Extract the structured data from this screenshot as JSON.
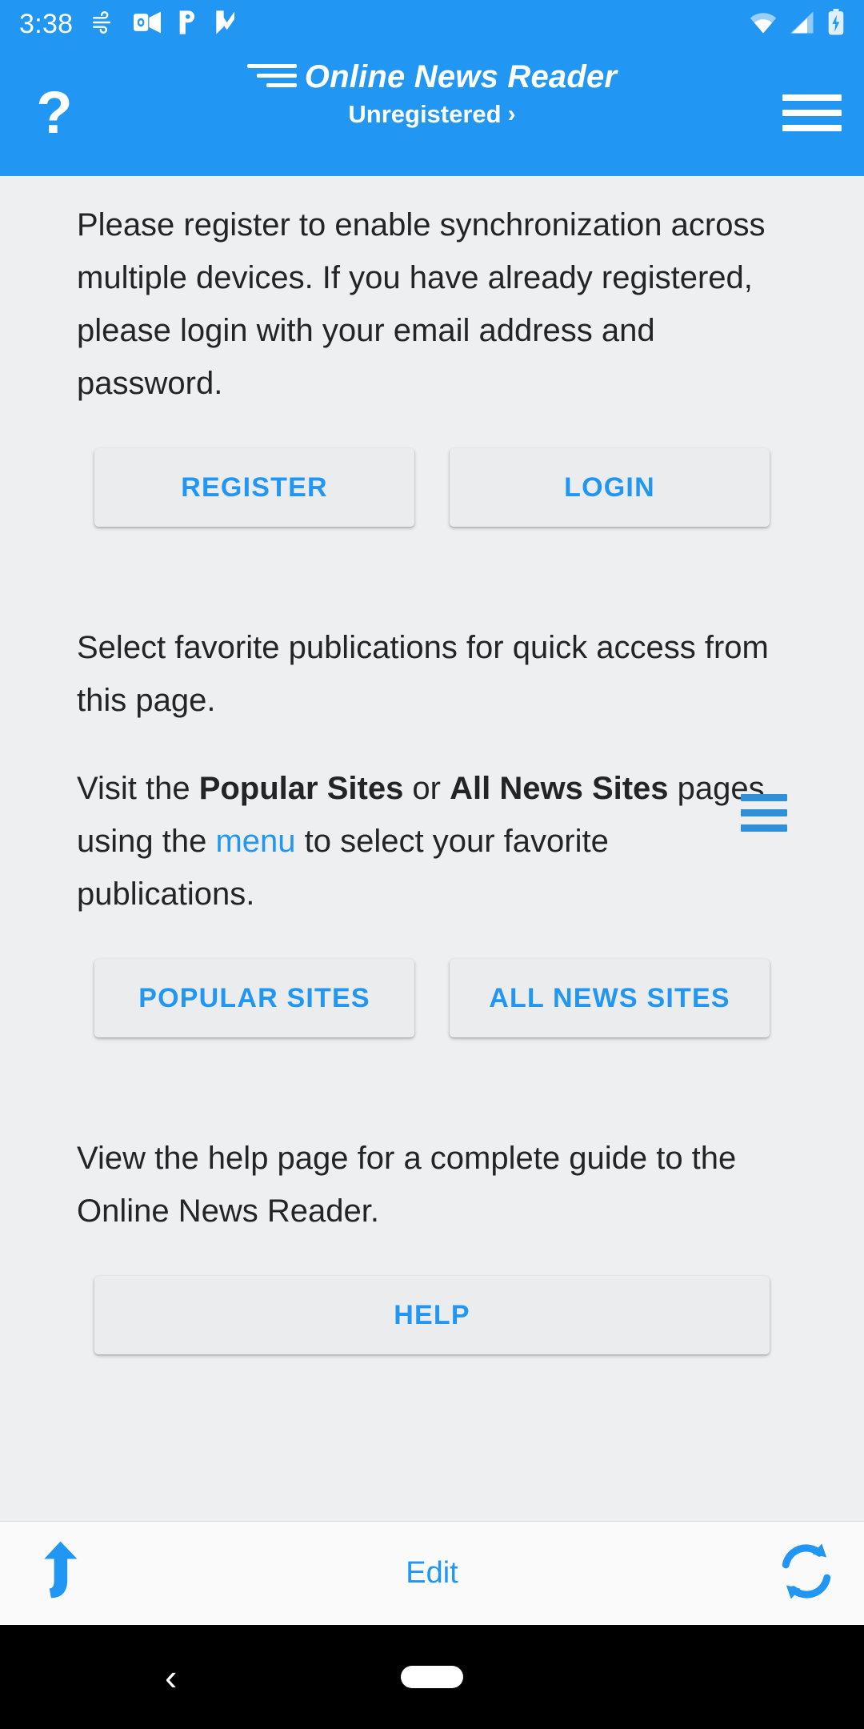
{
  "status_bar": {
    "time": "3:38",
    "left_icons": [
      "wind-icon",
      "outlook-icon",
      "pandora-icon",
      "todo-check-icon"
    ],
    "right_icons": [
      "wifi-icon",
      "cell-signal-icon",
      "battery-charging-icon"
    ]
  },
  "app_bar": {
    "help_glyph": "?",
    "title": "Online News Reader",
    "subtitle": "Unregistered",
    "subtitle_chevron": "›",
    "menu_icon": "hamburger-menu-icon",
    "background_color": "#2196f3"
  },
  "content": {
    "register_paragraph": "Please register to enable synchronization across multiple devices. If you have already registered, please login with your email address and password.",
    "register_button": "REGISTER",
    "login_button": "LOGIN",
    "favorites_paragraph": "Select favorite publications for quick access from this page.",
    "visit_line": {
      "prefix": "Visit the ",
      "bold1": "Popular Sites",
      "middle": " or ",
      "bold2": "All News Sites",
      "continued": " pages using the ",
      "link": "menu",
      "suffix": " to select your favorite publications."
    },
    "inline_menu_icon": "hamburger-menu-icon",
    "popular_sites_button": "POPULAR SITES",
    "all_news_sites_button": "ALL NEWS SITES",
    "help_paragraph": "View the help page for a complete guide to the Online News Reader.",
    "help_button": "HELP",
    "button_text_color": "#2196f3",
    "button_bg_color": "#ebecee",
    "page_bg_color": "#eeeff1"
  },
  "toolbar": {
    "back_icon": "curved-up-arrow-icon",
    "edit_label": "Edit",
    "refresh_icon": "sync-refresh-icon"
  },
  "nav_bar": {
    "back_glyph": "‹",
    "home_indicator": "home-pill-indicator"
  }
}
